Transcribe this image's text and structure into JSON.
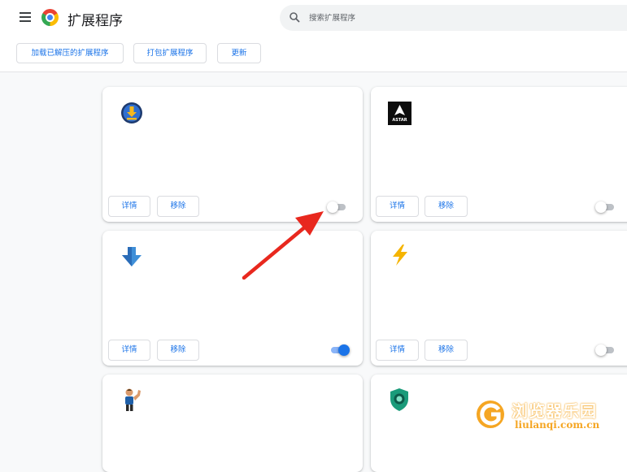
{
  "header": {
    "title": "扩展程序",
    "search_placeholder": "搜索扩展程序"
  },
  "toolbar": {
    "load_unpacked_label": "加载已解压的扩展程序",
    "pack_label": "打包扩展程序",
    "update_label": "更新"
  },
  "cards": [
    {
      "icon": "download-icon",
      "details_label": "详情",
      "remove_label": "移除",
      "enabled": false
    },
    {
      "icon": "astar-icon",
      "icon_text": "ASTAR",
      "details_label": "详情",
      "remove_label": "移除",
      "enabled": false
    },
    {
      "icon": "blue-down-arrow-icon",
      "details_label": "详情",
      "remove_label": "移除",
      "enabled": true
    },
    {
      "icon": "lightning-icon",
      "details_label": "详情",
      "remove_label": "移除",
      "enabled": false
    },
    {
      "icon": "flexing-man-icon"
    },
    {
      "icon": "shield-icon"
    }
  ],
  "watermark": {
    "title": "浏览器乐园",
    "url": "liulanqi.com.cn"
  },
  "colors": {
    "accent": "#1a73e8",
    "arrow": "#e8281e",
    "watermark": "#f5a623"
  }
}
